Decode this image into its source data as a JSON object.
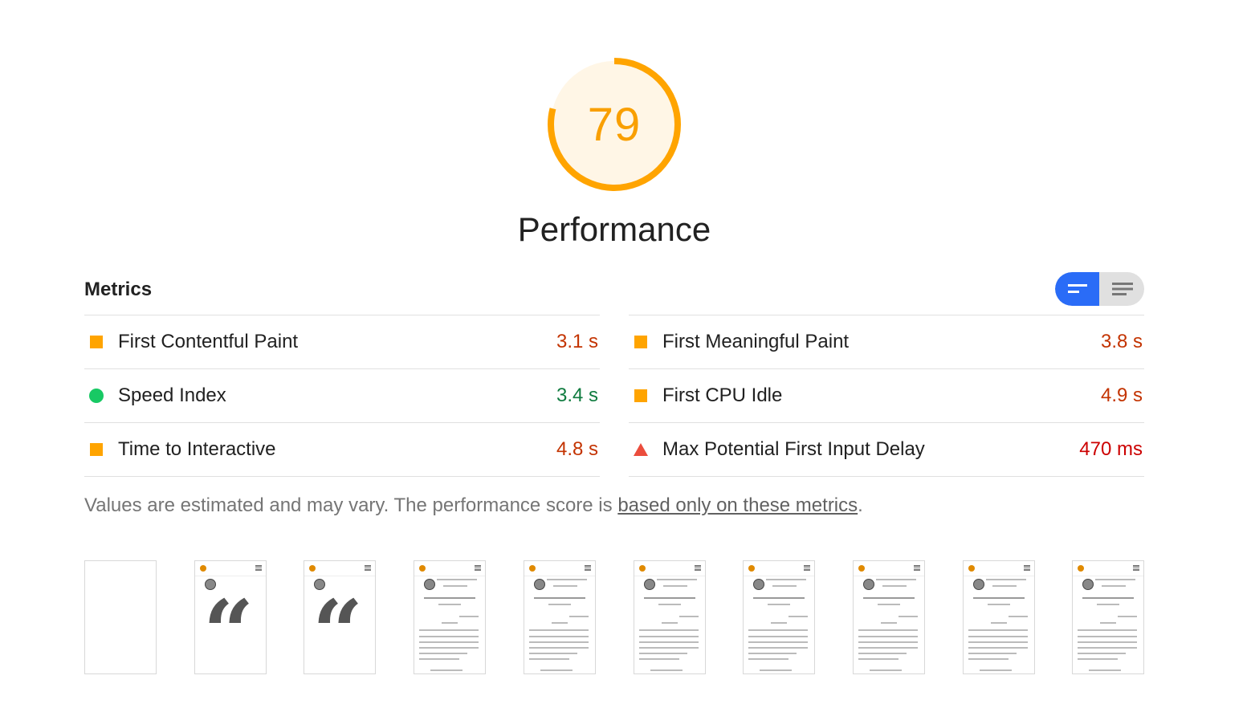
{
  "gauge": {
    "score": "79",
    "score_value": 79,
    "title": "Performance",
    "color": "#ffa400",
    "fill": "#fff6e6"
  },
  "metrics": {
    "header": "Metrics",
    "toggle": {
      "left_icon": "lines-compact-icon",
      "right_icon": "lines-expanded-icon",
      "active": "left"
    },
    "left_column": [
      {
        "label": "First Contentful Paint",
        "value": "3.1 s",
        "status": "average",
        "icon": "orange-square-icon"
      },
      {
        "label": "Speed Index",
        "value": "3.4 s",
        "status": "pass",
        "icon": "green-circle-icon"
      },
      {
        "label": "Time to Interactive",
        "value": "4.8 s",
        "status": "average",
        "icon": "orange-square-icon"
      }
    ],
    "right_column": [
      {
        "label": "First Meaningful Paint",
        "value": "3.8 s",
        "status": "average",
        "icon": "orange-square-icon"
      },
      {
        "label": "First CPU Idle",
        "value": "4.9 s",
        "status": "average",
        "icon": "orange-square-icon"
      },
      {
        "label": "Max Potential First Input Delay",
        "value": "470 ms",
        "status": "fail",
        "icon": "red-triangle-icon"
      }
    ]
  },
  "note": {
    "before": "Values are estimated and may vary. The performance score is ",
    "link": "based only on these metrics",
    "after": "."
  },
  "filmstrip": {
    "frames": [
      {
        "kind": "blank"
      },
      {
        "kind": "quote"
      },
      {
        "kind": "quote"
      },
      {
        "kind": "content"
      },
      {
        "kind": "content"
      },
      {
        "kind": "content"
      },
      {
        "kind": "content"
      },
      {
        "kind": "content"
      },
      {
        "kind": "content"
      },
      {
        "kind": "content"
      }
    ]
  },
  "colors": {
    "average": "#c33300",
    "pass": "#0f7b3f",
    "fail": "#cc0000",
    "toggle_active": "#2a6cf7"
  }
}
